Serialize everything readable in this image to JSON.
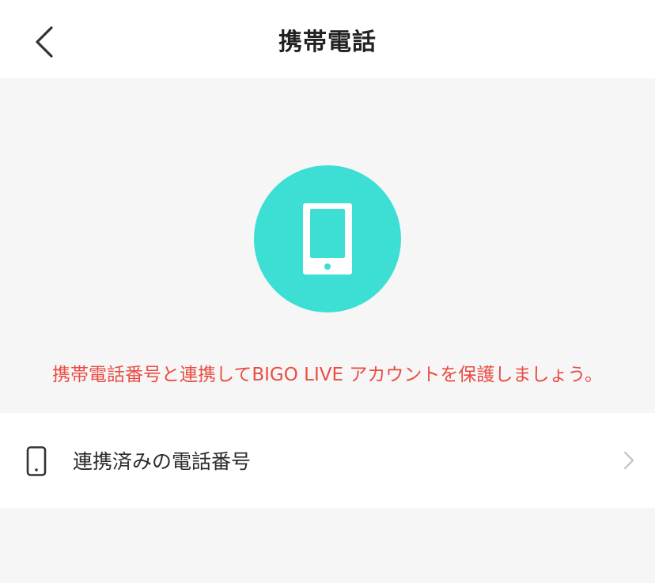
{
  "header": {
    "title": "携帯電話",
    "back_icon": "chevron-left-icon"
  },
  "hero": {
    "icon": "smartphone-icon",
    "icon_bg_color": "#3ddfd5",
    "notice": "携帯電話番号と連携してBIGO LIVE アカウントを保護しましょう。",
    "notice_color": "#e94d43"
  },
  "list": {
    "items": [
      {
        "icon": "smartphone-outline-icon",
        "label": "連携済みの電話番号",
        "trailing_icon": "chevron-right-icon"
      }
    ]
  }
}
